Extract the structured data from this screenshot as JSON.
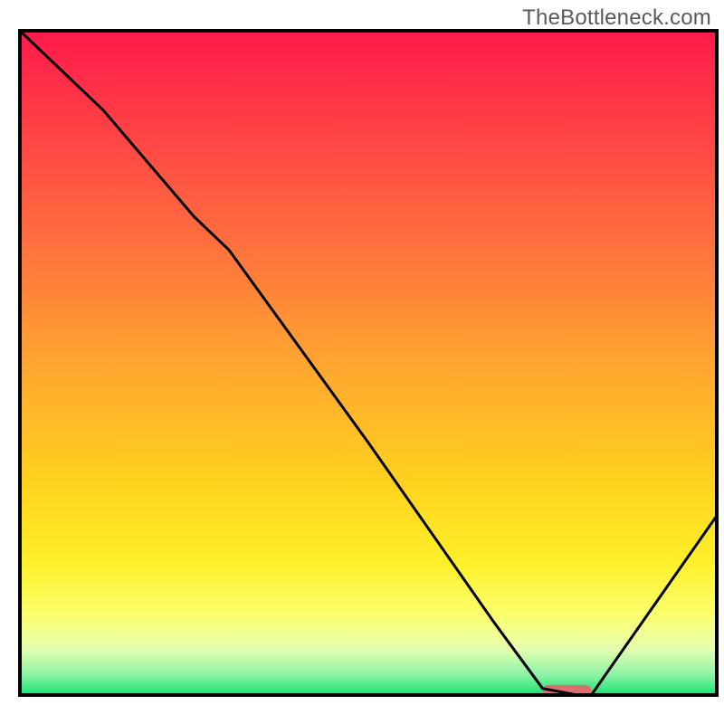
{
  "watermark": "TheBottleneck.com",
  "chart_data": {
    "type": "line",
    "title": "",
    "xlabel": "",
    "ylabel": "",
    "xlim": [
      0,
      100
    ],
    "ylim": [
      0,
      100
    ],
    "series": [
      {
        "name": "curve",
        "x": [
          0,
          12,
          25,
          30,
          50,
          68,
          75,
          80,
          82,
          100
        ],
        "y": [
          100,
          88,
          72,
          67,
          38,
          11,
          1,
          0,
          0,
          27
        ]
      }
    ],
    "marker": {
      "x_start": 75,
      "x_end": 82,
      "y": 0.7
    },
    "gradient_stops": [
      {
        "offset": 0,
        "color": "#ff1a4b"
      },
      {
        "offset": 12,
        "color": "#ff3a47"
      },
      {
        "offset": 30,
        "color": "#ff6a3f"
      },
      {
        "offset": 50,
        "color": "#ffa531"
      },
      {
        "offset": 68,
        "color": "#ffd21f"
      },
      {
        "offset": 80,
        "color": "#fff029"
      },
      {
        "offset": 88,
        "color": "#fbff6e"
      },
      {
        "offset": 93,
        "color": "#e6ffb0"
      },
      {
        "offset": 97,
        "color": "#8cf2a6"
      },
      {
        "offset": 100,
        "color": "#17e36e"
      }
    ],
    "frame_color": "#000000",
    "marker_color": "#d9706e"
  }
}
